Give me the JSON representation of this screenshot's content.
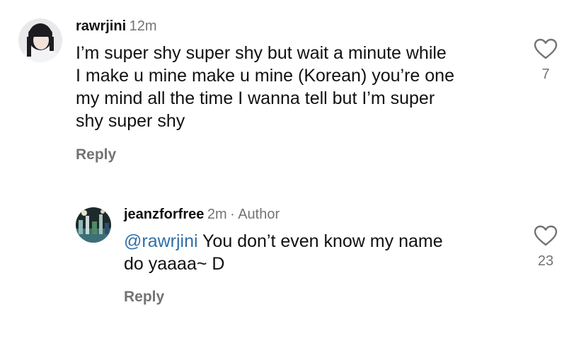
{
  "comments": [
    {
      "avatar_icon": "profile-photo",
      "username": "rawrjini",
      "time": "12m",
      "text": "I’m super shy super shy but wait a minute while\nI make u mine make u mine (Korean) you’re one\nmy mind all the time I wanna tell but I’m super\nshy super shy",
      "reply_label": "Reply",
      "like_icon": "heart-outline-icon",
      "like_count": "7"
    },
    {
      "avatar_icon": "profile-photo",
      "username": "jeanzforfree",
      "time": "2m",
      "separator": "·",
      "badge": "Author",
      "mention": "@rawrjini",
      "text": " You don’t even know my name\ndo yaaaa~ D",
      "reply_label": "Reply",
      "like_icon": "heart-outline-icon",
      "like_count": "23"
    }
  ],
  "colors": {
    "secondary_text": "#737373",
    "mention": "#2e6fa8",
    "primary_text": "#111111"
  }
}
